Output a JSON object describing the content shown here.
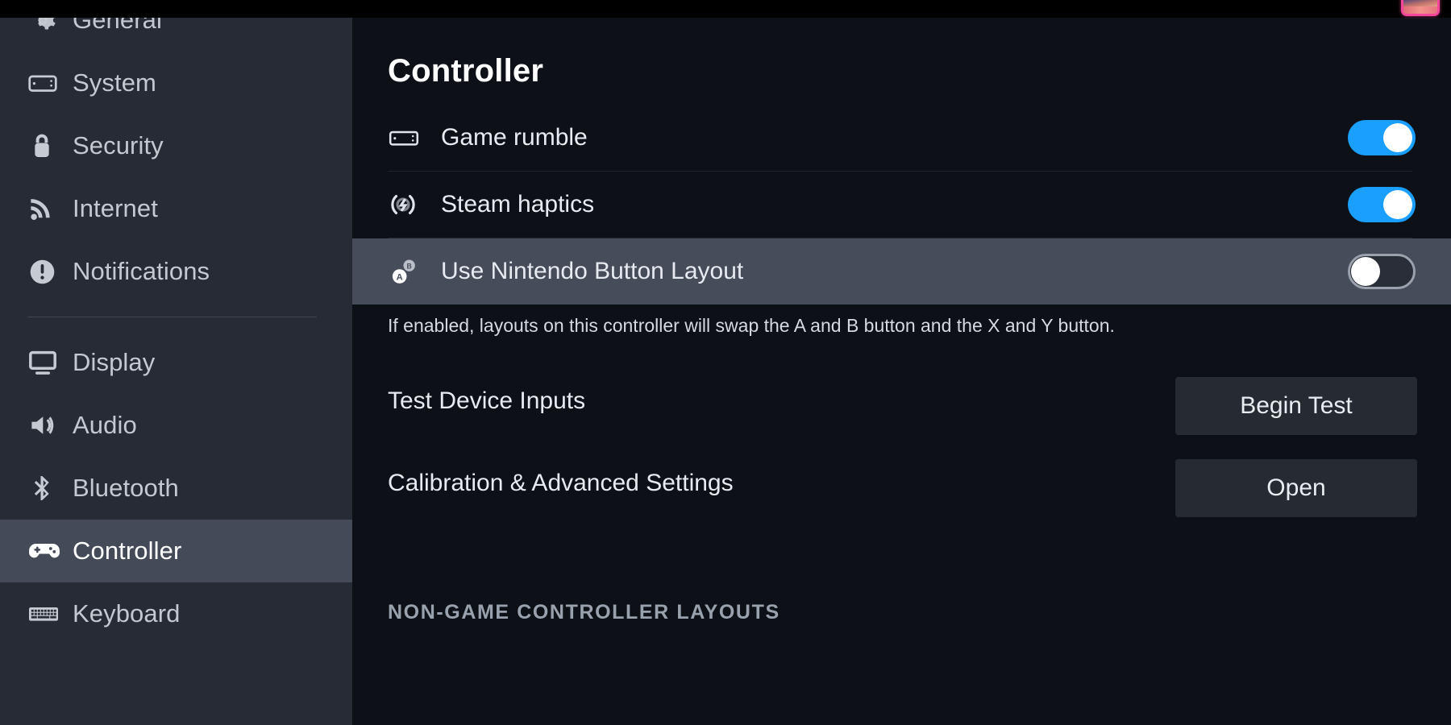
{
  "window": {
    "top_bar_faint_text": "",
    "thumbnail_name": "game-thumbnail"
  },
  "sidebar": {
    "items": [
      {
        "id": "general",
        "label": "General",
        "icon": "gear-icon",
        "selected": false
      },
      {
        "id": "system",
        "label": "System",
        "icon": "handheld-icon",
        "selected": false
      },
      {
        "id": "security",
        "label": "Security",
        "icon": "lock-icon",
        "selected": false
      },
      {
        "id": "internet",
        "label": "Internet",
        "icon": "wifi-icon",
        "selected": false
      },
      {
        "id": "notifications",
        "label": "Notifications",
        "icon": "alert-circle-icon",
        "selected": false
      },
      {
        "id": "display",
        "label": "Display",
        "icon": "monitor-icon",
        "selected": false
      },
      {
        "id": "audio",
        "label": "Audio",
        "icon": "speaker-icon",
        "selected": false
      },
      {
        "id": "bluetooth",
        "label": "Bluetooth",
        "icon": "bluetooth-icon",
        "selected": false
      },
      {
        "id": "controller",
        "label": "Controller",
        "icon": "gamepad-icon",
        "selected": true
      },
      {
        "id": "keyboard",
        "label": "Keyboard",
        "icon": "keyboard-icon",
        "selected": false
      }
    ]
  },
  "main": {
    "title": "Controller",
    "settings": [
      {
        "id": "game-rumble",
        "label": "Game rumble",
        "icon": "handheld-rumble-icon",
        "state": "on",
        "highlighted": false
      },
      {
        "id": "steam-haptics",
        "label": "Steam haptics",
        "icon": "haptics-icon",
        "state": "on",
        "highlighted": false
      },
      {
        "id": "nintendo-layout",
        "label": "Use Nintendo Button Layout",
        "icon": "ab-buttons-icon",
        "state": "off",
        "highlighted": true
      }
    ],
    "description": "If enabled, layouts on this controller will swap the A and B button and the X and Y button.",
    "actions": [
      {
        "id": "test-device-inputs",
        "label": "Test Device Inputs",
        "button_label": "Begin Test"
      },
      {
        "id": "calibration-advanced",
        "label": "Calibration & Advanced Settings",
        "button_label": "Open"
      }
    ],
    "section_header": "NON-GAME CONTROLLER LAYOUTS"
  },
  "colors": {
    "accent_toggle_on": "#1a9fff",
    "sidebar_bg": "#272b35",
    "sidebar_selected": "#454a58",
    "main_bg": "#0d1117",
    "row_highlight": "#474c5b",
    "button_bg": "#262a33",
    "thumbnail_border": "#f4469b"
  }
}
